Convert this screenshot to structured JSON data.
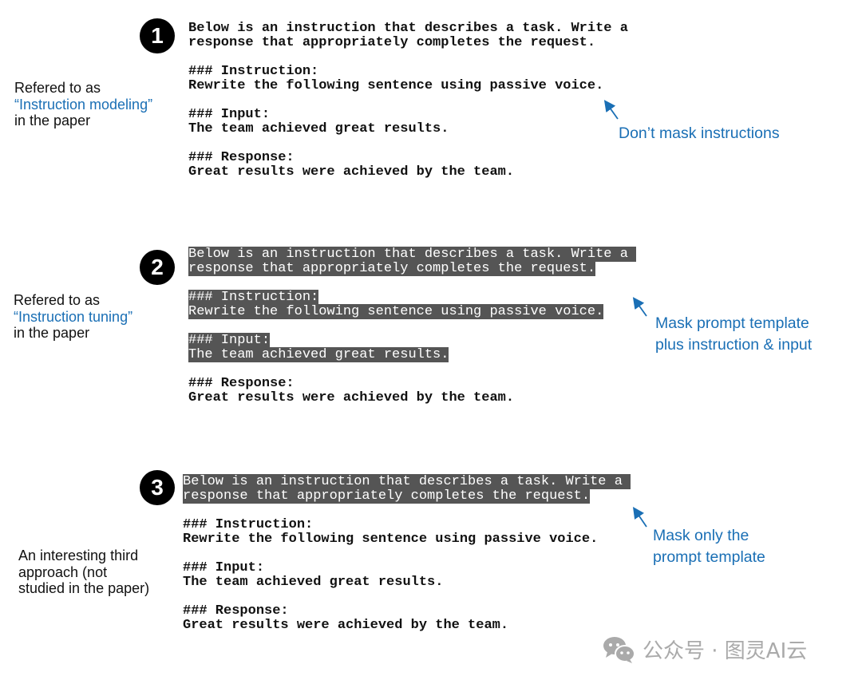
{
  "colors": {
    "accent": "#1a6fb5",
    "mask": "#555555"
  },
  "blocks": [
    {
      "number": "1",
      "label": [
        "Refered to as",
        "“Instruction modeling”",
        "in the paper"
      ],
      "note": [
        "Don’t mask instructions"
      ],
      "lines": [
        {
          "text": "Below is an instruction that describes a task. Write a",
          "masked": false
        },
        {
          "text": "response that appropriately completes the request.",
          "masked": false
        },
        {
          "text": "",
          "masked": false
        },
        {
          "text": "### Instruction:",
          "masked": false
        },
        {
          "text": "Rewrite the following sentence using passive voice.",
          "masked": false
        },
        {
          "text": "",
          "masked": false
        },
        {
          "text": "### Input:",
          "masked": false
        },
        {
          "text": "The team achieved great results.",
          "masked": false
        },
        {
          "text": "",
          "masked": false
        },
        {
          "text": "### Response:",
          "masked": false
        },
        {
          "text": "Great results were achieved by the team.",
          "masked": false
        }
      ]
    },
    {
      "number": "2",
      "label": [
        "Refered to as",
        "“Instruction tuning”",
        "in the paper"
      ],
      "note": [
        "Mask prompt template",
        "plus instruction & input"
      ],
      "lines": [
        {
          "text": "Below is an instruction that describes a task. Write a ",
          "masked": true
        },
        {
          "text": "response that appropriately completes the request.",
          "masked": true
        },
        {
          "text": "",
          "masked": false
        },
        {
          "text": "### Instruction:",
          "masked": true
        },
        {
          "text": "Rewrite the following sentence using passive voice.",
          "masked": true
        },
        {
          "text": "",
          "masked": false
        },
        {
          "text": "### Input:",
          "masked": true
        },
        {
          "text": "The team achieved great results.",
          "masked": true
        },
        {
          "text": "",
          "masked": false
        },
        {
          "text": "### Response:",
          "masked": false
        },
        {
          "text": "Great results were achieved by the team.",
          "masked": false
        }
      ]
    },
    {
      "number": "3",
      "label": [
        "An interesting third",
        "approach (not",
        "studied in the paper)"
      ],
      "note": [
        "Mask only the",
        "prompt template"
      ],
      "lines": [
        {
          "text": "Below is an instruction that describes a task. Write a ",
          "masked": true
        },
        {
          "text": "response that appropriately completes the request.",
          "masked": true
        },
        {
          "text": "",
          "masked": false
        },
        {
          "text": "### Instruction:",
          "masked": false
        },
        {
          "text": "Rewrite the following sentence using passive voice.",
          "masked": false
        },
        {
          "text": "",
          "masked": false
        },
        {
          "text": "### Input:",
          "masked": false
        },
        {
          "text": "The team achieved great results.",
          "masked": false
        },
        {
          "text": "",
          "masked": false
        },
        {
          "text": "### Response:",
          "masked": false
        },
        {
          "text": "Great results were achieved by the team.",
          "masked": false
        }
      ]
    }
  ],
  "watermark": {
    "icon": "wechat-icon",
    "text": "公众号 · 图灵AI云"
  }
}
